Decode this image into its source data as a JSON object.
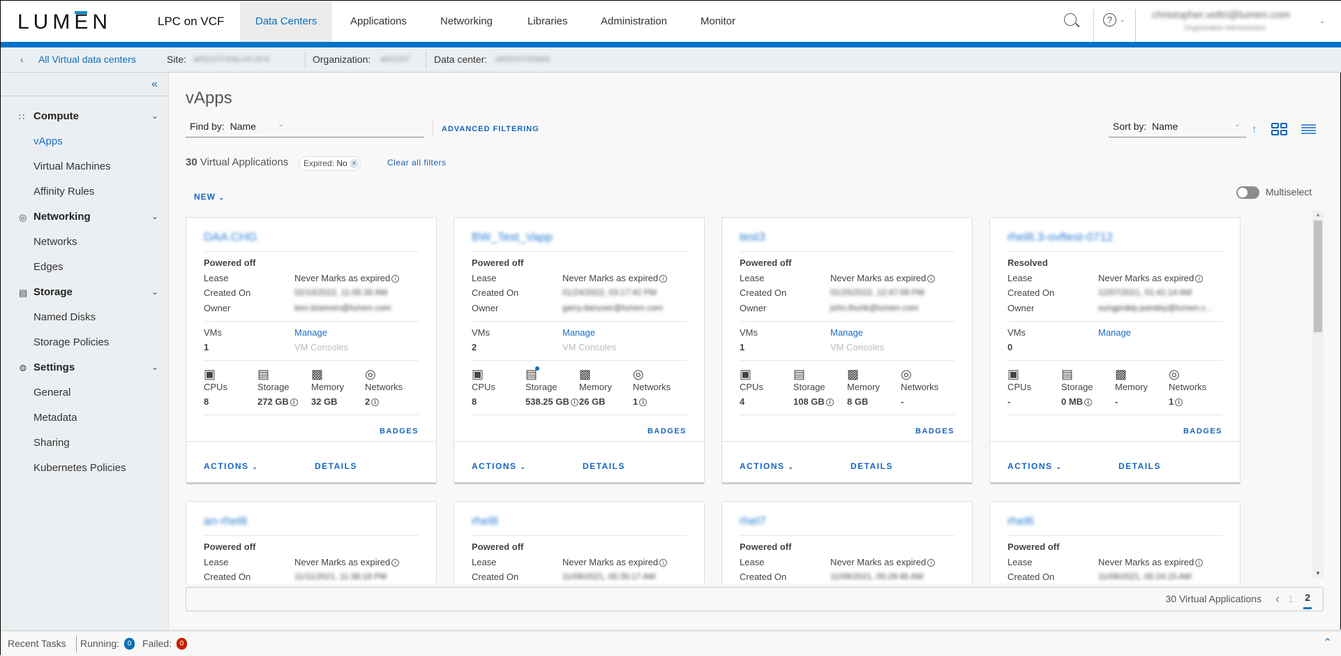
{
  "header": {
    "logo": "LUMEN",
    "product": "LPC on VCF",
    "nav": [
      "Data Centers",
      "Applications",
      "Networking",
      "Libraries",
      "Administration",
      "Monitor"
    ],
    "active_nav": "Data Centers",
    "user_email": "christopher.veltri@lumen.com",
    "user_role": "Organization Administrator"
  },
  "subheader": {
    "back": "All Virtual data centers",
    "site_label": "Site:",
    "site_value": "a602107c63a.vcf.ctl.io",
    "org_label": "Organization:",
    "org_value": "a602107",
    "dc_label": "Data center:",
    "dc_value": "a602107c63a01"
  },
  "sidebar": {
    "sections": [
      {
        "label": "Compute",
        "icon": "grid-icon",
        "items": [
          "vApps",
          "Virtual Machines",
          "Affinity Rules"
        ]
      },
      {
        "label": "Networking",
        "icon": "network-icon",
        "items": [
          "Networks",
          "Edges"
        ]
      },
      {
        "label": "Storage",
        "icon": "storage-icon",
        "items": [
          "Named Disks",
          "Storage Policies"
        ]
      },
      {
        "label": "Settings",
        "icon": "gear-icon",
        "items": [
          "General",
          "Metadata",
          "Sharing",
          "Kubernetes Policies"
        ]
      }
    ],
    "active": "vApps"
  },
  "page": {
    "title": "vApps",
    "find_label": "Find by:",
    "find_value": "Name",
    "advanced": "ADVANCED FILTERING",
    "sort_label": "Sort by:",
    "sort_value": "Name",
    "count": "30",
    "count_label": "Virtual Applications",
    "chip_label": "Expired:",
    "chip_value": "No",
    "clear": "Clear all filters",
    "new": "NEW",
    "multiselect": "Multiselect",
    "multiselect_on": false
  },
  "labels": {
    "lease": "Lease",
    "created": "Created On",
    "owner": "Owner",
    "vms": "VMs",
    "manage": "Manage",
    "consoles": "VM Consoles",
    "cpus": "CPUs",
    "storage": "Storage",
    "memory": "Memory",
    "networks": "Networks",
    "badges": "BADGES",
    "actions": "ACTIONS",
    "details": "DETAILS",
    "lease_value": "Never Marks as expired"
  },
  "cards": [
    {
      "name": "DAA CHG",
      "status": "Powered off",
      "created": "02/10/2022, 11:05:30 AM",
      "owner": "ben.brannen@lumen.com",
      "vms": "1",
      "consoles": true,
      "cpus": "8",
      "storage": "272 GB",
      "memory": "32 GB",
      "networks": "2"
    },
    {
      "name": "BW_Test_Vapp",
      "status": "Powered off",
      "created": "01/24/2022, 03:17:42 PM",
      "owner": "garry.danuser@lumen.com",
      "vms": "2",
      "consoles": true,
      "cpus": "8",
      "storage": "538.25 GB",
      "memory": "26 GB",
      "networks": "1",
      "storage_dot": true
    },
    {
      "name": "test3",
      "status": "Powered off",
      "created": "01/25/2022, 12:47:09 PM",
      "owner": "john.thurik@lumen.com",
      "vms": "1",
      "consoles": true,
      "cpus": "4",
      "storage": "108 GB",
      "memory": "8 GB",
      "networks": "-"
    },
    {
      "name": "rhel8.3-ovftest-0712",
      "status": "Resolved",
      "created": "12/07/2021, 01:41:14 AM",
      "owner": "sungprdep.pandey@lumen.c...",
      "vms": "0",
      "consoles": false,
      "cpus": "-",
      "storage": "0 MB",
      "memory": "-",
      "networks": "1"
    },
    {
      "name": "an-rhel8",
      "status": "Powered off",
      "created": "11/11/2021, 11:38:18 PM"
    },
    {
      "name": "rhel8",
      "status": "Powered off",
      "created": "11/09/2021, 05:35:17 AM"
    },
    {
      "name": "rhel7",
      "status": "Powered off",
      "created": "11/09/2021, 05:29:45 AM"
    },
    {
      "name": "rhel6",
      "status": "Powered off",
      "created": "11/09/2021, 05:24:15 AM"
    }
  ],
  "pagination": {
    "total": "30 Virtual Applications",
    "pages": [
      "1",
      "2"
    ],
    "current": "2"
  },
  "status": {
    "recent": "Recent Tasks",
    "running_label": "Running:",
    "running": "0",
    "failed_label": "Failed:",
    "failed": "0"
  },
  "colors": {
    "accent": "#0073c8",
    "running": "#0b6fb5",
    "failed": "#c92100"
  }
}
